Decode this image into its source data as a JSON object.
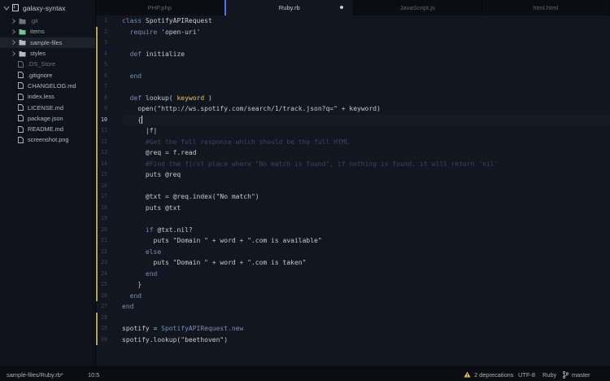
{
  "project": {
    "name": "galaxy-syntax"
  },
  "tree": {
    "folders": [
      {
        "name": ".git",
        "state": "ignored",
        "expanded": false
      },
      {
        "name": "items",
        "state": "added",
        "expanded": false
      },
      {
        "name": "sample-files",
        "state": "selected",
        "expanded": false
      },
      {
        "name": "styles",
        "state": "normal",
        "expanded": false
      }
    ],
    "files": [
      {
        "name": ".DS_Store",
        "state": "ignored"
      },
      {
        "name": ".gitignore",
        "state": "normal"
      },
      {
        "name": "CHANGELOG.md",
        "state": "normal"
      },
      {
        "name": "index.less",
        "state": "normal"
      },
      {
        "name": "LICENSE.md",
        "state": "normal"
      },
      {
        "name": "package.json",
        "state": "normal"
      },
      {
        "name": "README.md",
        "state": "normal"
      },
      {
        "name": "screenshot.png",
        "state": "normal"
      }
    ]
  },
  "tabs": [
    {
      "label": "PHP.php",
      "active": false,
      "modified": false
    },
    {
      "label": "Ruby.rb",
      "active": true,
      "modified": true
    },
    {
      "label": "JavaScript.js",
      "active": false,
      "modified": false
    },
    {
      "label": "html.html",
      "active": false,
      "modified": false
    }
  ],
  "editor": {
    "current_line": 10,
    "lines": [
      [
        [
          "kw",
          "class "
        ],
        [
          "pl",
          "SpotifyAPIRequest"
        ]
      ],
      [
        [
          "kw",
          "  require "
        ],
        [
          "str",
          "'open-uri'"
        ]
      ],
      [],
      [
        [
          "kw",
          "  def "
        ],
        [
          "pl",
          "initialize"
        ]
      ],
      [],
      [
        [
          "kw",
          "  end"
        ]
      ],
      [],
      [
        [
          "kw",
          "  def "
        ],
        [
          "pl",
          "lookup( "
        ],
        [
          "param",
          "keyword"
        ],
        [
          "pl",
          " )"
        ]
      ],
      [
        [
          "pl",
          "    open("
        ],
        [
          "str",
          "\"http://ws.spotify.com/search/1/track.json?q=\""
        ],
        [
          "pl",
          " + keyword)"
        ]
      ],
      [
        [
          "pl",
          "    {"
        ]
      ],
      [
        [
          "pl",
          "      |f|"
        ]
      ],
      [
        [
          "cmt",
          "      #Get the full response which should be the full HTML"
        ]
      ],
      [
        [
          "pl",
          "      @req = f.read"
        ]
      ],
      [
        [
          "cmt",
          "      #Find the first place where \"No match is found\", if nothing is found, it will return 'nil'"
        ]
      ],
      [
        [
          "pl",
          "      puts @req"
        ]
      ],
      [],
      [
        [
          "pl",
          "      @txt = @req.index("
        ],
        [
          "str",
          "\"No match\""
        ],
        [
          "pl",
          ")"
        ]
      ],
      [
        [
          "pl",
          "      puts @txt"
        ]
      ],
      [],
      [
        [
          "kw",
          "      if "
        ],
        [
          "pl",
          "@txt.nil?"
        ]
      ],
      [
        [
          "pl",
          "        puts "
        ],
        [
          "str",
          "\"Domain \""
        ],
        [
          "pl",
          " + word + "
        ],
        [
          "str",
          "\".com is available\""
        ]
      ],
      [
        [
          "kw",
          "      else"
        ]
      ],
      [
        [
          "pl",
          "        puts "
        ],
        [
          "str",
          "\"Domain \""
        ],
        [
          "pl",
          " + word + "
        ],
        [
          "str",
          "\".com is taken\""
        ]
      ],
      [
        [
          "kw",
          "      end"
        ]
      ],
      [
        [
          "pl",
          "    }"
        ]
      ],
      [
        [
          "kw",
          "  end"
        ]
      ],
      [
        [
          "kw",
          "end"
        ]
      ],
      [],
      [
        [
          "pl",
          "spotify = "
        ],
        [
          "kw",
          "SpotifyAPIRequest.new"
        ]
      ],
      [
        [
          "pl",
          "spotify.lookup("
        ],
        [
          "str",
          "\"beethoven\""
        ],
        [
          "pl",
          ")"
        ]
      ]
    ]
  },
  "status": {
    "file_path": "sample-files/Ruby.rb*",
    "cursor_pos": "10:5",
    "deprecations": "2 deprecations",
    "encoding": "UTF-8",
    "grammar": "Ruby",
    "branch": "master"
  },
  "colors": {
    "accent": "#4a7bd6",
    "added": "#73c990",
    "warning": "#e2c05a",
    "git_modified_bar": "#b8a25b"
  }
}
